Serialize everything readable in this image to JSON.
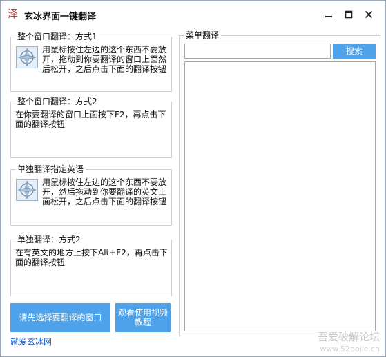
{
  "window": {
    "title": "玄冰界面一键翻译",
    "app_icon_char": "泽"
  },
  "groups": {
    "g1": {
      "legend": "整个窗口翻译：方式1",
      "desc": "用鼠标按住左边的这个东西不要放开，拖动到你要翻译的窗口上面然后松开，之后点击下面的翻译按钮"
    },
    "g2": {
      "legend": "整个窗口翻译：方式2",
      "desc": "在你要翻译的窗口上面按下F2，再点击下面的翻译按钮"
    },
    "g3": {
      "legend": "单独翻译指定英语",
      "desc": "用鼠标按住左边的这个东西不要放开，然后拖动到你要翻译的英文上面松开，之后点击下面的翻译按钮"
    },
    "g4": {
      "legend": "单独翻译：方式2",
      "desc": "在有英文的地方上按下Alt+F2，再点击下面的翻译按钮"
    }
  },
  "buttons": {
    "select_window": "请先选择要翻译的窗口",
    "watch_video": "观看使用视频教程",
    "search": "搜索"
  },
  "link": "就爱玄冰网",
  "menu_group": {
    "legend": "菜单翻译",
    "search_value": ""
  },
  "watermark": {
    "line1": "吾爱破解论坛",
    "line2": "www.52pojie.cn"
  },
  "colors": {
    "accent": "#4ea2e9",
    "link": "#1a5fc8"
  }
}
